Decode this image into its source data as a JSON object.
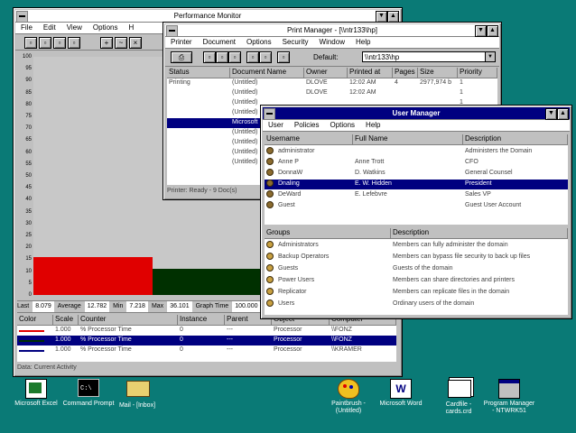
{
  "perfmon": {
    "title": "Performance Monitor",
    "menu": [
      "File",
      "Edit",
      "View",
      "Options",
      "H"
    ],
    "y_axis": [
      "100",
      "95",
      "90",
      "85",
      "80",
      "75",
      "70",
      "65",
      "60",
      "55",
      "50",
      "45",
      "40",
      "35",
      "30",
      "25",
      "20",
      "15",
      "10",
      "5",
      "0"
    ],
    "bars": [
      {
        "label": "red",
        "color": "#e00000",
        "value": 16
      },
      {
        "label": "green",
        "color": "#003000",
        "value": 11
      }
    ],
    "stats": {
      "last_label": "Last",
      "last_value": "8.079",
      "avg_label": "Average",
      "avg_value": "12.782",
      "min_label": "Min",
      "min_value": "7.218",
      "max_label": "Max",
      "max_value": "36.101",
      "graph_time_label": "Graph Time",
      "graph_time_value": "100.000"
    },
    "table_headers": [
      "Color",
      "Scale",
      "Counter",
      "Instance",
      "Parent",
      "Object",
      "Computer"
    ],
    "rows": [
      {
        "scale": "1.000",
        "counter": "% Processor Time",
        "instance": "0",
        "parent": "---",
        "object": "Processor",
        "computer": "\\\\FONZ",
        "color": "#e00000",
        "selected": false
      },
      {
        "scale": "1.000",
        "counter": "% Processor Time",
        "instance": "0",
        "parent": "---",
        "object": "Processor",
        "computer": "\\\\FONZ",
        "color": "#003000",
        "selected": true
      },
      {
        "scale": "1.000",
        "counter": "% Processor Time",
        "instance": "0",
        "parent": "---",
        "object": "Processor",
        "computer": "\\\\KRAMER",
        "color": "#000080",
        "selected": false
      }
    ],
    "status": "Data: Current Activity"
  },
  "printman": {
    "title": "Print Manager - [\\\\ntr133\\hp]",
    "menu": [
      "Printer",
      "Document",
      "Options",
      "Security",
      "Window",
      "Help"
    ],
    "default_label": "Default:",
    "default_value": "\\\\ntr133\\hp",
    "headers": [
      "Status",
      "Document Name",
      "Owner",
      "Printed at",
      "Pages",
      "Size",
      "Priority"
    ],
    "rows": [
      {
        "status": "Printing",
        "doc": "(Untitled)",
        "owner": "DLOVE",
        "printed": "12:02 AM",
        "pages": "4",
        "size": "2977,974 b",
        "priority": "1",
        "selected": false
      },
      {
        "status": "",
        "doc": "(Untitled)",
        "owner": "DLOVE",
        "printed": "12:02 AM",
        "pages": "",
        "size": "",
        "priority": "1",
        "selected": false
      },
      {
        "status": "",
        "doc": "(Untitled)",
        "owner": "",
        "printed": "",
        "pages": "",
        "size": "",
        "priority": "1",
        "selected": false
      },
      {
        "status": "",
        "doc": "(Untitled)",
        "owner": "",
        "printed": "",
        "pages": "",
        "size": "",
        "priority": "",
        "selected": false
      },
      {
        "status": "",
        "doc": "Microsoft",
        "owner": "",
        "printed": "",
        "pages": "",
        "size": "",
        "priority": "",
        "selected": true
      },
      {
        "status": "",
        "doc": "(Untitled)",
        "owner": "",
        "printed": "",
        "pages": "",
        "size": "",
        "priority": "",
        "selected": false
      },
      {
        "status": "",
        "doc": "(Untitled)",
        "owner": "",
        "printed": "",
        "pages": "",
        "size": "",
        "priority": "",
        "selected": false
      },
      {
        "status": "",
        "doc": "(Untitled)",
        "owner": "",
        "printed": "",
        "pages": "",
        "size": "",
        "priority": "",
        "selected": false
      },
      {
        "status": "",
        "doc": "(Untitled)",
        "owner": "",
        "printed": "",
        "pages": "",
        "size": "",
        "priority": "",
        "selected": false
      }
    ],
    "status": "Printer: Ready - 9 Doc(s)"
  },
  "userman": {
    "title": "User Manager",
    "menu": [
      "User",
      "Policies",
      "Options",
      "Help"
    ],
    "user_headers": [
      "Username",
      "Full Name",
      "Description"
    ],
    "users": [
      {
        "username": "administrator",
        "fullname": "",
        "description": "Administers the Domain",
        "selected": false
      },
      {
        "username": "Anne P",
        "fullname": "Anne Trott",
        "description": "CFO",
        "selected": false
      },
      {
        "username": "DonnaW",
        "fullname": "D. Watkins",
        "description": "General Counsel",
        "selected": false
      },
      {
        "username": "Dnaling",
        "fullname": "E. W. Hidden",
        "description": "President",
        "selected": true
      },
      {
        "username": "DeWard",
        "fullname": "E. Lefebvre",
        "description": "Sales VP",
        "selected": false
      },
      {
        "username": "Guest",
        "fullname": "",
        "description": "Guest User Account",
        "selected": false
      }
    ],
    "group_headers": [
      "Groups",
      "Description"
    ],
    "groups": [
      {
        "name": "Administrators",
        "description": "Members can fully administer the domain"
      },
      {
        "name": "Backup Operators",
        "description": "Members can bypass file security to back up files"
      },
      {
        "name": "Guests",
        "description": "Guests of the domain"
      },
      {
        "name": "Power Users",
        "description": "Members can share directories and printers"
      },
      {
        "name": "Replicator",
        "description": "Members can replicate files in the domain"
      },
      {
        "name": "Users",
        "description": "Ordinary users of the domain"
      }
    ]
  },
  "desktop_icons": [
    {
      "label": "Microsoft Excel",
      "icon": "excel-icon"
    },
    {
      "label": "Command Prompt",
      "icon": "command-prompt-icon"
    },
    {
      "label": "Mail - [Inbox]",
      "icon": "mail-icon"
    },
    {
      "label": "Paintbrush - (Untitled)",
      "icon": "paintbrush-icon"
    },
    {
      "label": "Microsoft Word",
      "icon": "word-icon"
    },
    {
      "label": "Cardfile - cards.crd",
      "icon": "cardfile-icon"
    },
    {
      "label": "Program Manager - NTWRK51",
      "icon": "program-manager-icon"
    }
  ]
}
